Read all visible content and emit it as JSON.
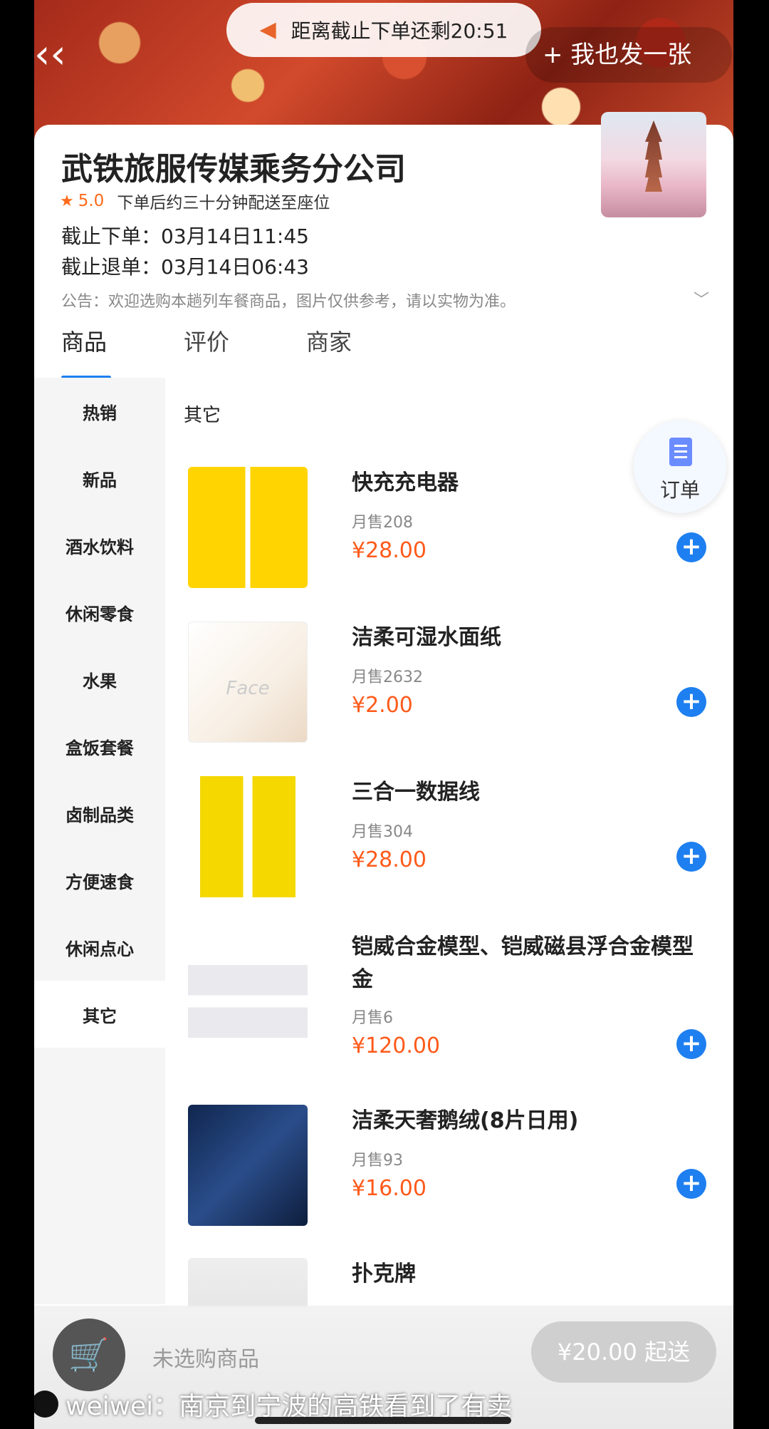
{
  "banner": {
    "deadline_text": "距离截止下单还剩20:51",
    "share_label": "+ 我也发一张"
  },
  "shop": {
    "name": "武铁旅服传媒乘务分公司",
    "rating": "5.0",
    "delivery_note": "下单后约三十分钟配送至座位",
    "order_deadline": "截止下单：03月14日11:45",
    "refund_deadline": "截止退单：03月14日06:43",
    "notice": "公告：欢迎选购本趟列车餐商品，图片仅供参考，请以实物为准。"
  },
  "tabs": [
    "商品",
    "评价",
    "商家"
  ],
  "sidebar": {
    "items": [
      {
        "label": "热销"
      },
      {
        "label": "新品"
      },
      {
        "label": "酒水饮料"
      },
      {
        "label": "休闲零食"
      },
      {
        "label": "水果"
      },
      {
        "label": "盒饭套餐"
      },
      {
        "label": "卤制品类"
      },
      {
        "label": "方便速食"
      },
      {
        "label": "休闲点心"
      },
      {
        "label": "其它"
      }
    ],
    "active": "其它"
  },
  "section_title": "其它",
  "products": [
    {
      "name": "快充充电器",
      "sales": "月售208",
      "price": "¥28.00"
    },
    {
      "name": "洁柔可湿水面纸",
      "sales": "月售2632",
      "price": "¥2.00",
      "image_text": "Face"
    },
    {
      "name": "三合一数据线",
      "sales": "月售304",
      "price": "¥28.00"
    },
    {
      "name": "铠威合金模型、铠威磁县浮合金模型金",
      "sales": "月售6",
      "price": "¥120.00"
    },
    {
      "name": "洁柔天奢鹅绒(8片日用)",
      "sales": "月售93",
      "price": "¥16.00"
    },
    {
      "name": "扑克牌",
      "sales": "",
      "price": ""
    }
  ],
  "order_fab": {
    "label": "订单"
  },
  "bottom_bar": {
    "empty_text": "未选购商品",
    "min_order": "¥20.00 起送"
  },
  "caption": {
    "text": "weiwei：南京到宁波的高铁看到了有卖"
  },
  "colors": {
    "accent": "#1e7ff0",
    "price": "#ff5a1a",
    "rating": "#ff6a1a"
  },
  "icons": [
    "back-icon",
    "megaphone-icon",
    "cart-icon",
    "add-icon",
    "order-icon",
    "chevron-down-icon",
    "star-icon"
  ]
}
